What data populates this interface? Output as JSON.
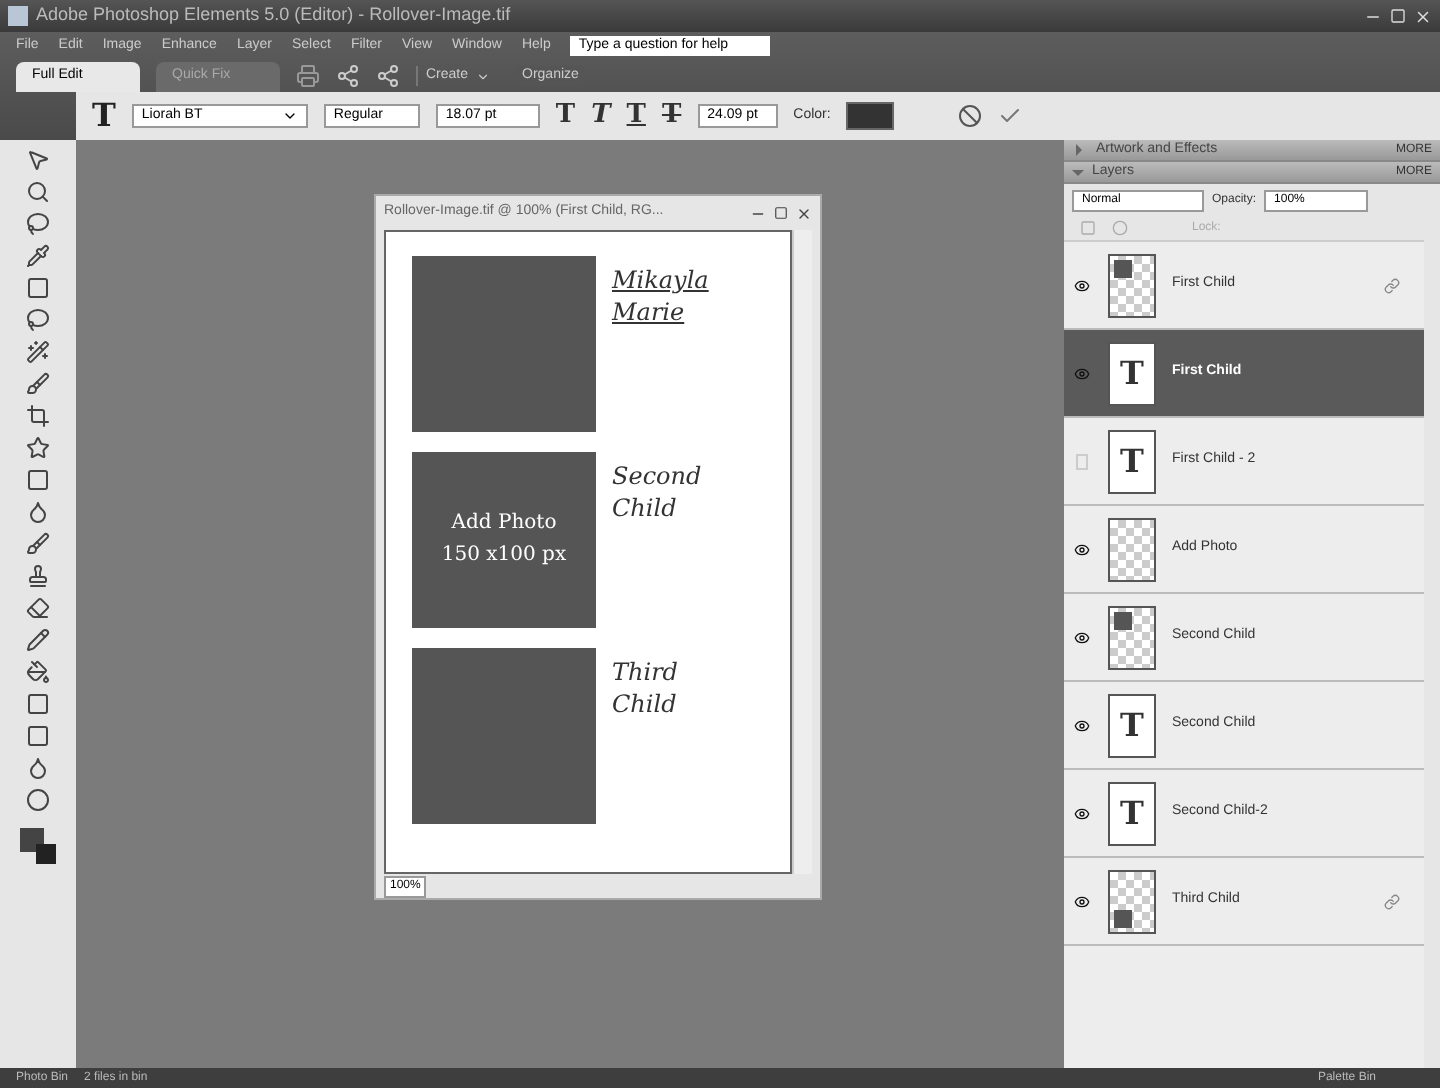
{
  "window": {
    "title": "Adobe Photoshop Elements 5.0 (Editor) - Rollover-Image.tif"
  },
  "menu": [
    "File",
    "Edit",
    "Image",
    "Enhance",
    "Layer",
    "Select",
    "Filter",
    "View",
    "Window",
    "Help"
  ],
  "help_search": {
    "value": "Type a question for help"
  },
  "modes": [
    {
      "label": "Full Edit",
      "selected": true
    },
    {
      "label": "Quick Fix",
      "selected": false
    }
  ],
  "shortcuts": [
    {
      "label": "Create",
      "kind": "create"
    },
    {
      "label": "Organize",
      "kind": "organize"
    }
  ],
  "options": {
    "tool": "T",
    "font": "Liorah BT",
    "style": "Regular",
    "size": "18.07 pt",
    "leading": "24.09 pt",
    "color_label": "Color:",
    "styles": [
      "T",
      "T",
      "T",
      "T"
    ]
  },
  "document": {
    "title": "Rollover-Image.tif @ 100% (First Child, RG...",
    "zoom": "100%",
    "slots": [
      {
        "names": [
          "Mikayla",
          "Marie"
        ],
        "underlined": true
      },
      {
        "caption": [
          "Add Photo",
          "150 x100 px"
        ],
        "names": [
          "Second",
          "Child"
        ],
        "underlined": false
      },
      {
        "names": [
          "Third",
          "Child"
        ],
        "underlined": false
      }
    ]
  },
  "palettes": [
    {
      "label": "Artwork and Effects",
      "more": "MORE",
      "expanded": false
    },
    {
      "label": "Layers",
      "more": "MORE",
      "expanded": true
    }
  ],
  "layers_panel": {
    "blend": "Normal",
    "opacity_label": "Opacity:",
    "opacity": "100%",
    "lock_label": "Lock:",
    "layers": [
      {
        "name": "First Child",
        "kind": "image",
        "visible": true,
        "selected": false,
        "linked": true
      },
      {
        "name": "First Child",
        "kind": "text",
        "glyph": "T",
        "visible": true,
        "selected": true,
        "linked": false
      },
      {
        "name": "First Child - 2",
        "kind": "text",
        "glyph": "T",
        "visible": false,
        "selected": false,
        "linked": false
      },
      {
        "name": "Add Photo",
        "kind": "empty",
        "visible": true,
        "selected": false,
        "linked": false
      },
      {
        "name": "Second Child",
        "kind": "image",
        "visible": true,
        "selected": false,
        "linked": false
      },
      {
        "name": "Second Child",
        "kind": "text",
        "glyph": "T",
        "visible": true,
        "selected": false,
        "linked": false
      },
      {
        "name": "Second Child-2",
        "kind": "text",
        "glyph": "T",
        "visible": true,
        "selected": false,
        "linked": false
      },
      {
        "name": "Third Child",
        "kind": "image-low",
        "visible": true,
        "selected": false,
        "linked": true
      }
    ]
  },
  "status_bar": {
    "photo_bin": "Photo Bin",
    "files": "2 files in bin",
    "palette_bin": "Palette Bin"
  }
}
